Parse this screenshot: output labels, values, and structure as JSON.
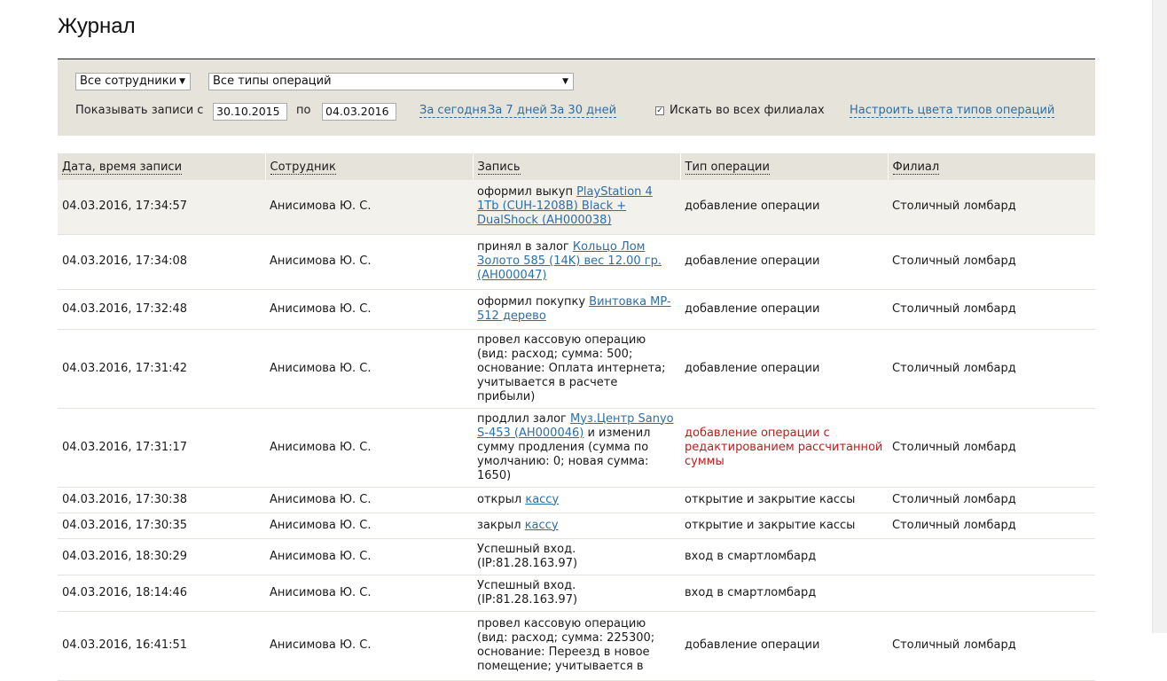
{
  "page": {
    "title": "Журнал"
  },
  "filters": {
    "employees_select": "Все сотрудники",
    "op_types_select": "Все типы операций",
    "show_from_label": "Показывать записи с",
    "date_from": "30.10.2015",
    "to_label": "по",
    "date_to": "04.03.2016",
    "quick": [
      "За сегодня",
      "За 7 дней",
      "За 30 дней"
    ],
    "search_all_branches_label": "Искать во всех филиалах",
    "search_all_branches_checked": true,
    "configure_colors_link": "Настроить цвета типов операций"
  },
  "table": {
    "headers": [
      "Дата, время записи",
      "Сотрудник",
      "Запись",
      "Тип операции",
      "Филиал"
    ],
    "rows": [
      {
        "datetime": "04.03.2016, 17:34:57",
        "employee": "Анисимова Ю. С.",
        "pre": "оформил выкуп ",
        "link": "PlayStation 4 1Tb (CUH-1208B) Black + DualShock (АН000038)",
        "post": "",
        "type": "добавление операции",
        "branch": "Столичный ломбард"
      },
      {
        "datetime": "04.03.2016, 17:34:08",
        "employee": "Анисимова Ю. С.",
        "pre": "принял в залог ",
        "link": "Кольцо Лом Золото 585 (14K) вес 12.00 гр. (АН000047)",
        "post": "",
        "type": "добавление операции",
        "branch": "Столичный ломбард"
      },
      {
        "datetime": "04.03.2016, 17:32:48",
        "employee": "Анисимова Ю. С.",
        "pre": "оформил покупку ",
        "link": "Винтовка MP-512 дерево",
        "post": "",
        "type": "добавление операции",
        "branch": "Столичный ломбард"
      },
      {
        "datetime": "04.03.2016, 17:31:42",
        "employee": "Анисимова Ю. С.",
        "pre": "провел кассовую операцию (вид: расход; сумма: 500; основание: Оплата интернета; учитывается в расчете прибыли)",
        "link": "",
        "post": "",
        "type": "добавление операции",
        "branch": "Столичный ломбард"
      },
      {
        "datetime": "04.03.2016, 17:31:17",
        "employee": "Анисимова Ю. С.",
        "pre": "продлил залог ",
        "link": "Муз.Центр Sanyo S-453 (АН000046)",
        "post": " и изменил сумму продления (сумма по умолчанию: 0; новая сумма: 1650)",
        "type": "добавление операции с редактированием рассчитанной суммы",
        "type_red": true,
        "branch": "Столичный ломбард"
      },
      {
        "datetime": "04.03.2016, 17:30:38",
        "employee": "Анисимова Ю. С.",
        "pre": "открыл ",
        "link": "кассу",
        "post": "",
        "type": "открытие и закрытие кассы",
        "branch": "Столичный ломбард"
      },
      {
        "datetime": "04.03.2016, 17:30:35",
        "employee": "Анисимова Ю. С.",
        "pre": "закрыл ",
        "link": "кассу",
        "post": "",
        "type": "открытие и закрытие кассы",
        "branch": "Столичный ломбард"
      },
      {
        "datetime": "04.03.2016, 18:30:29",
        "employee": "Анисимова Ю. С.",
        "pre": "Успешный вход. (IP:81.28.163.97)",
        "link": "",
        "post": "",
        "type": "вход в смартломбард",
        "branch": ""
      },
      {
        "datetime": "04.03.2016, 18:14:46",
        "employee": "Анисимова Ю. С.",
        "pre": "Успешный вход. (IP:81.28.163.97)",
        "link": "",
        "post": "",
        "type": "вход в смартломбард",
        "branch": ""
      },
      {
        "datetime": "04.03.2016, 16:41:51",
        "employee": "Анисимова Ю. С.",
        "pre": "провел кассовую операцию (вид: расход; сумма: 225300; основание: Переезд в новое помещение; учитывается в",
        "link": "",
        "post": "",
        "type": "добавление операции",
        "branch": "Столичный ломбард"
      }
    ]
  },
  "colors": {
    "link": "#2c6fa8",
    "panel_bg": "#e6e3da",
    "alert_text": "#c41a1a"
  }
}
